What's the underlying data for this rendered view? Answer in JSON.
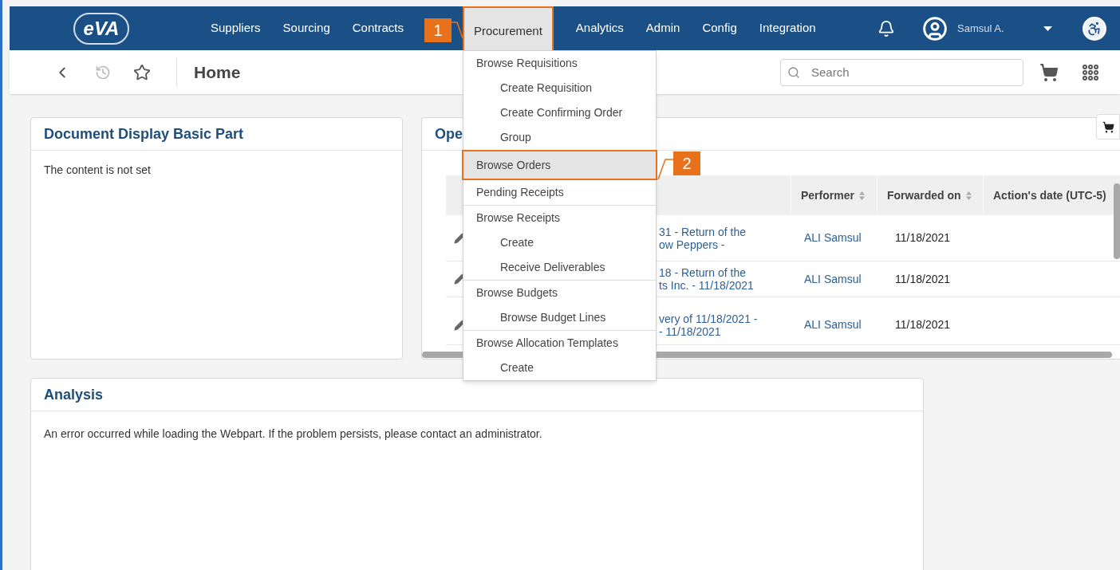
{
  "nav": {
    "logo": "eVA",
    "items": [
      {
        "label": "Suppliers",
        "selected": false
      },
      {
        "label": "Sourcing",
        "selected": false
      },
      {
        "label": "Contracts",
        "selected": false
      },
      {
        "label": "Procurement",
        "selected": true,
        "callout": "1"
      },
      {
        "label": "Analytics",
        "selected": false
      },
      {
        "label": "Admin",
        "selected": false
      },
      {
        "label": "Config",
        "selected": false
      },
      {
        "label": "Integration",
        "selected": false
      }
    ],
    "user": "Samsul A."
  },
  "menu": {
    "groups": [
      [
        {
          "label": "Browse Requisitions",
          "selected": false,
          "children": [
            {
              "label": "Create Requisition",
              "selected": false
            },
            {
              "label": "Create Confirming Order",
              "selected": false
            },
            {
              "label": "Group",
              "selected": false
            }
          ]
        },
        {
          "label": "Browse Orders",
          "selected": true,
          "callout": "2"
        },
        {
          "label": "Pending Receipts",
          "selected": false
        }
      ],
      [
        {
          "label": "Browse Receipts",
          "selected": false,
          "children": [
            {
              "label": "Create",
              "selected": false
            },
            {
              "label": "Receive Deliverables",
              "selected": false
            }
          ]
        }
      ],
      [
        {
          "label": "Browse Budgets",
          "selected": false,
          "children": [
            {
              "label": "Browse Budget Lines",
              "selected": false
            }
          ]
        }
      ],
      [
        {
          "label": "Browse Allocation Templates",
          "selected": false,
          "children": [
            {
              "label": "Create",
              "selected": false
            }
          ]
        }
      ]
    ]
  },
  "toolbar": {
    "title": "Home",
    "search": {
      "placeholder": "Search"
    }
  },
  "document_panel": {
    "title": "Document Display Basic Part",
    "body": "The content is not set"
  },
  "open_panel": {
    "title": "Ope",
    "columns": [
      {
        "label": "Performer",
        "sortable": true
      },
      {
        "label": "Forwarded on",
        "sortable": true
      },
      {
        "label": "Action's date (UTC-5)",
        "sortable": false
      }
    ],
    "rows": [
      {
        "description": [
          "31 - Return of the",
          "ow Peppers -"
        ],
        "performer": "ALI Samsul",
        "forwarded_on": "11/18/2021"
      },
      {
        "description": [
          "18 - Return of the",
          "ts Inc. - 11/18/2021"
        ],
        "performer": "ALI Samsul",
        "forwarded_on": "11/18/2021"
      },
      {
        "description": [
          "very of 11/18/2021 -",
          "- 11/18/2021"
        ],
        "performer": "ALI Samsul",
        "forwarded_on": "11/18/2021"
      }
    ]
  },
  "analysis_panel": {
    "title": "Analysis",
    "message": "An error occurred while loading the Webpart. If the problem persists, please contact an administrator."
  }
}
